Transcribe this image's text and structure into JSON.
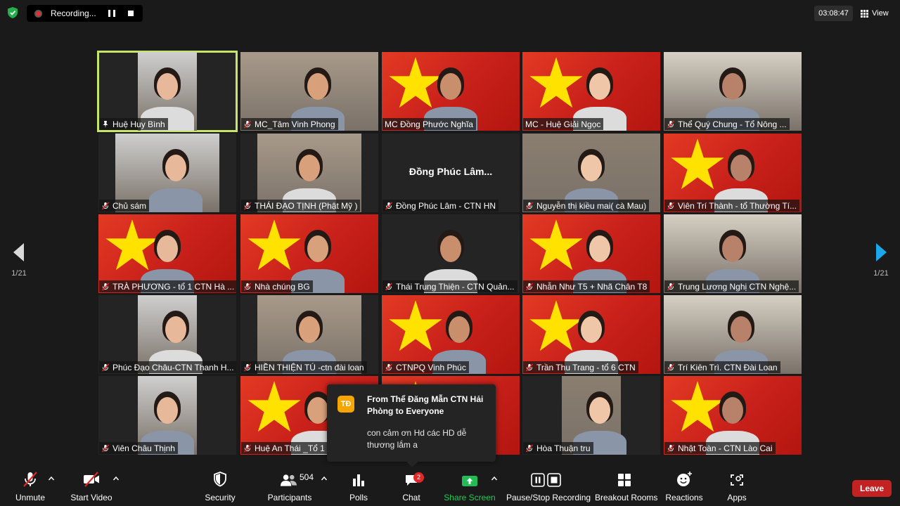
{
  "recording": {
    "label": "Recording..."
  },
  "timer": "03:08:47",
  "view_label": "View",
  "pagination": {
    "left": "1/21",
    "right": "1/21"
  },
  "tiles": [
    {
      "name": "Huệ Huy Bình",
      "bg": "room",
      "active": true,
      "pinned": true
    },
    {
      "name": "MC_Tâm Vinh Phong",
      "bg": "room",
      "muted": true
    },
    {
      "name": "MC Đồng Phước Nghĩa",
      "bg": "flag"
    },
    {
      "name": "MC - Huệ Giải Ngọc",
      "bg": "flag"
    },
    {
      "name": "Thể Quý Chung - Tổ Nông ...",
      "bg": "room",
      "muted": true
    },
    {
      "name": "Chủ sám",
      "bg": "room",
      "muted": true
    },
    {
      "name": "THÁI ĐẠO TỊNH (Phật Mỹ )",
      "bg": "room",
      "muted": true
    },
    {
      "name": "Đồng Phúc Lâm -  CTN HN",
      "bg": "dark",
      "muted": true,
      "center_name": "Đồng Phúc Lâm..."
    },
    {
      "name": "Nguyễn thị kiều mai( cà Mau)",
      "bg": "room",
      "muted": true
    },
    {
      "name": "Viên Trí Thành - tổ Thường Tí...",
      "bg": "flag",
      "muted": true
    },
    {
      "name": "TRÀ PHƯƠNG - tổ 1 CTN Hà ...",
      "bg": "flag",
      "muted": true
    },
    {
      "name": "Nhà chúng BG",
      "bg": "flag",
      "muted": true
    },
    {
      "name": "Thái Trung Thiện - CTN Quản...",
      "bg": "dark",
      "muted": true
    },
    {
      "name": "Nhẫn Như T5 + Nhã Chân T8",
      "bg": "flag",
      "muted": true
    },
    {
      "name": "Trung Lương Nghị CTN Nghệ...",
      "bg": "room",
      "muted": true
    },
    {
      "name": "Phúc Đạo Châu-CTN Thanh H...",
      "bg": "room",
      "muted": true
    },
    {
      "name": "HIỀN THIỆN TÚ -ctn đài loan",
      "bg": "room",
      "muted": true
    },
    {
      "name": "CTNPQ Vinh Phúc",
      "bg": "flag",
      "muted": true
    },
    {
      "name": "Trần Thu Trang - tổ 6 CTN",
      "bg": "flag",
      "muted": true
    },
    {
      "name": "Trí Kiên Trì. CTN Đài Loan",
      "bg": "room",
      "muted": true
    },
    {
      "name": "Viên Châu Thịnh",
      "bg": "room",
      "muted": true
    },
    {
      "name": "Huệ An Thái _Tổ 1",
      "bg": "flag",
      "muted": true
    },
    {
      "name": "",
      "bg": "flag",
      "muted": false
    },
    {
      "name": "Hòa Thuận tru",
      "bg": "room",
      "muted": true
    },
    {
      "name": "Nhật Toàn - CTN Lào Cai",
      "bg": "flag",
      "muted": true
    }
  ],
  "chat_popup": {
    "avatar": "TĐ",
    "from": "From Thể Đăng Mẫn CTN Hải Phòng to Everyone",
    "message": "con cảm ơn Hd các HD dễ thương lắm a"
  },
  "toolbar": {
    "unmute": "Unmute",
    "start_video": "Start Video",
    "security": "Security",
    "participants": "Participants",
    "participants_count": "504",
    "polls": "Polls",
    "chat": "Chat",
    "chat_badge": "2",
    "share_screen": "Share Screen",
    "pause_recording": "Pause/Stop Recording",
    "breakout_rooms": "Breakout Rooms",
    "reactions": "Reactions",
    "apps": "Apps",
    "leave": "Leave"
  },
  "colors": {
    "accent_green": "#22bb55",
    "leave_red": "#c22222",
    "active_speaker": "#c6e56a",
    "flag_red": "#d62a1f",
    "star_yellow": "#ffe200"
  }
}
